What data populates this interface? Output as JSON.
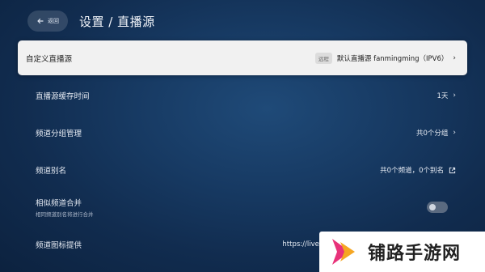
{
  "header": {
    "back_label": "返回",
    "title": "设置 / 直播源"
  },
  "rows": [
    {
      "label": "自定义直播源",
      "badge": "远程",
      "value": "默认直播源 fanmingming（IPV6）",
      "chevron": "›"
    },
    {
      "label": "直播源缓存时间",
      "value": "1天",
      "chevron": "›"
    },
    {
      "label": "频道分组管理",
      "value": "共0个分组",
      "chevron": "›"
    },
    {
      "label": "频道别名",
      "value": "共0个频道，0个别名"
    },
    {
      "label": "相似频道合并",
      "sublabel": "相同频道别名将进行合并",
      "toggle": false
    },
    {
      "label": "频道图标提供",
      "value": "https://live.fanmingming"
    }
  ],
  "watermark": {
    "text": "铺路手游网"
  },
  "colors": {
    "selected_bg": "#f1f1f1",
    "bg_dark": "#0c223f",
    "bg_mid": "#1f4a78",
    "watermark_accent": "#e8327a"
  }
}
